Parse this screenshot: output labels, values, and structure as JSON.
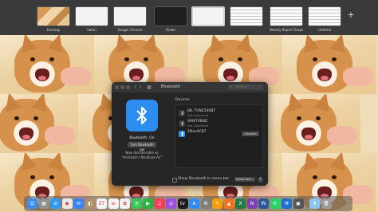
{
  "spaces": [
    {
      "label": "Desktop",
      "style": "doge"
    },
    {
      "label": "Safari",
      "style": "white"
    },
    {
      "label": "Google Chrome",
      "style": "white"
    },
    {
      "label": "Finder",
      "style": "dark"
    },
    {
      "label": "",
      "style": "active"
    },
    {
      "label": "",
      "style": "doc"
    },
    {
      "label": "Weekly Report Template",
      "style": "doc"
    },
    {
      "label": "Untitled",
      "style": "doc"
    }
  ],
  "add_space_icon": "plus-icon",
  "bluetooth": {
    "title": "Bluetooth",
    "search_placeholder": "Search",
    "status": "Bluetooth: On",
    "toggle_label": "Turn Bluetooth Off",
    "discoverable": "Now discoverable as",
    "device_name": "“Hrishabh’s MacBook Air”",
    "devices_header": "Devices",
    "devices": [
      {
        "name": "JBL TUNE500BT",
        "status": "Not Connected",
        "connected": false,
        "has_connect_button": false
      },
      {
        "name": "XM4TV6NZ",
        "status": "Not Connected",
        "connected": false,
        "has_connect_button": false
      },
      {
        "name": "2DecAC87",
        "status": "",
        "connected": true,
        "has_connect_button": true
      }
    ],
    "connect_label": "Connect",
    "show_in_menubar_label": "Show Bluetooth in menu bar",
    "advanced_label": "Advanced...",
    "help_label": "?"
  },
  "dock": {
    "apps": [
      {
        "name": "finder",
        "color": "#3a8ef0",
        "glyph": "☺"
      },
      {
        "name": "launchpad",
        "color": "#8f8f8f",
        "glyph": "▦"
      },
      {
        "name": "safari",
        "color": "#2f9bf0",
        "glyph": "⊘"
      },
      {
        "name": "chrome",
        "color": "#e9e9e9",
        "glyph": "◉"
      },
      {
        "name": "mail",
        "color": "#3b82f6",
        "glyph": "✉"
      },
      {
        "name": "contacts",
        "color": "#b08f6a",
        "glyph": "◧"
      },
      {
        "name": "calendar",
        "color": "#f5f5f5",
        "glyph": "27"
      },
      {
        "name": "reminders",
        "color": "#f3f3f3",
        "glyph": "≡"
      },
      {
        "name": "photos",
        "color": "#f0f0f0",
        "glyph": "✿"
      },
      {
        "name": "messages",
        "color": "#34c759",
        "glyph": "◔"
      },
      {
        "name": "facetime",
        "color": "#2fb344",
        "glyph": "▶"
      },
      {
        "name": "music",
        "color": "#fa3d5b",
        "glyph": "♫"
      },
      {
        "name": "podcasts",
        "color": "#9b4de0",
        "glyph": "◎"
      },
      {
        "name": "tv",
        "color": "#1c1c1c",
        "glyph": "tv"
      },
      {
        "name": "app-store",
        "color": "#2f8cf0",
        "glyph": "A"
      },
      {
        "name": "system-preferences",
        "color": "#7d7d7d",
        "glyph": "⚙"
      },
      {
        "name": "pages",
        "color": "#f59e0b",
        "glyph": "✎"
      },
      {
        "name": "vlc",
        "color": "#f97316",
        "glyph": "▲"
      },
      {
        "name": "excel",
        "color": "#1f7a44",
        "glyph": "X"
      },
      {
        "name": "onenote",
        "color": "#7b3fb5",
        "glyph": "N"
      },
      {
        "name": "word",
        "color": "#2b5797",
        "glyph": "W"
      },
      {
        "name": "whatsapp",
        "color": "#25d366",
        "glyph": "✆"
      },
      {
        "name": "xcode",
        "color": "#1f6fd1",
        "glyph": "⚒"
      },
      {
        "name": "screenshot",
        "color": "#555555",
        "glyph": "▣"
      },
      {
        "name": "downloads",
        "color": "#8cc4f5",
        "glyph": "⬇"
      },
      {
        "name": "trash",
        "color": "#9a9a9a",
        "glyph": "🗑"
      }
    ]
  }
}
